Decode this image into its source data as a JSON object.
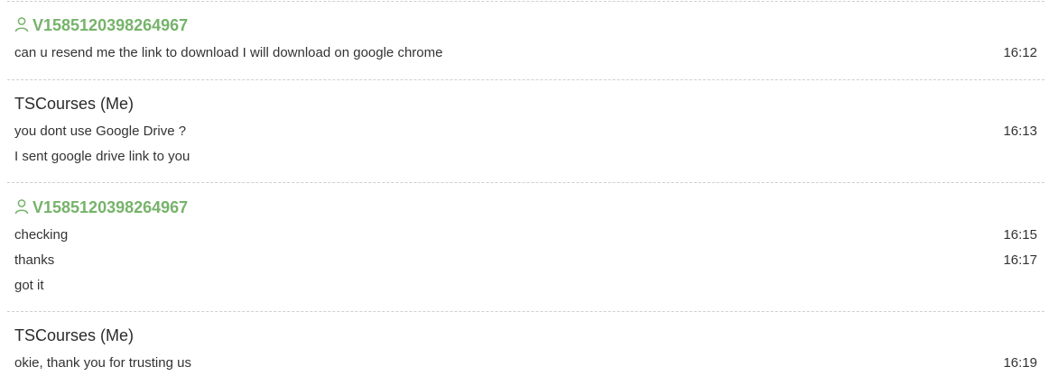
{
  "theme": {
    "user_color": "#76b36a",
    "me_color": "#2b2b2b",
    "divider_color": "#cfcfcf"
  },
  "groups": [
    {
      "sender": "V1585120398264967",
      "icon": "user-icon",
      "messages": [
        {
          "text": "can u resend me the link to download I will download on google chrome",
          "time": "16:12"
        }
      ]
    },
    {
      "sender": "TSCourses (Me)",
      "messages": [
        {
          "text": "you dont use Google Drive ?",
          "time": "16:13"
        },
        {
          "text": "I sent google drive link to you",
          "time": ""
        }
      ]
    },
    {
      "sender": "V1585120398264967",
      "icon": "user-icon",
      "messages": [
        {
          "text": "checking",
          "time": "16:15"
        },
        {
          "text": "thanks",
          "time": "16:17"
        },
        {
          "text": "got it",
          "time": ""
        }
      ]
    },
    {
      "sender": "TSCourses (Me)",
      "messages": [
        {
          "text": "okie, thank you for trusting us",
          "time": "16:19"
        }
      ]
    }
  ]
}
